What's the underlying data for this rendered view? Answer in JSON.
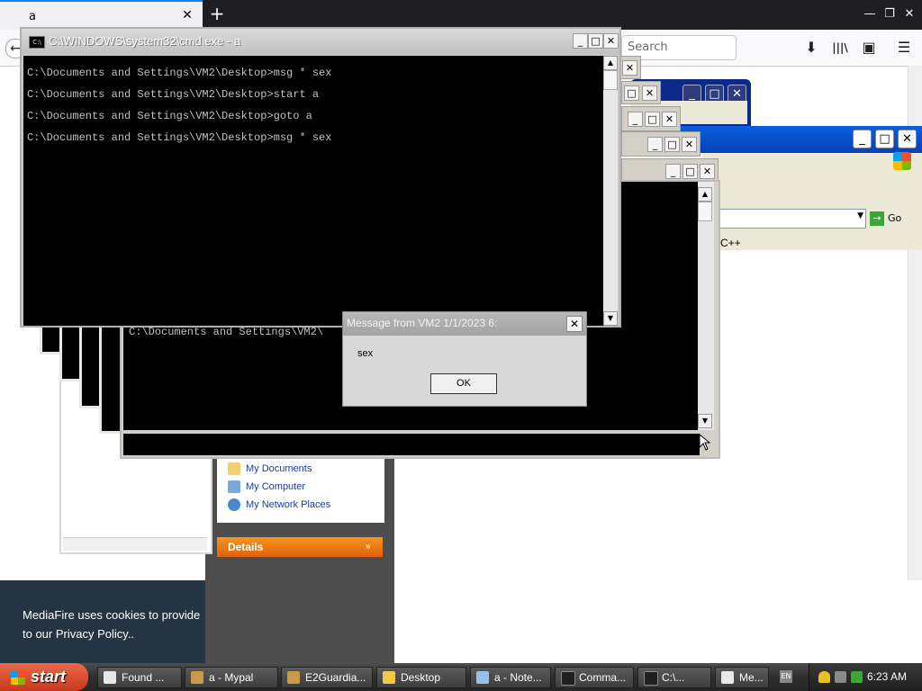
{
  "browser": {
    "tab_title": "a",
    "tab_close": "✕",
    "new_tab": "+",
    "search_placeholder": "Search",
    "back_icon": "←",
    "download_icon": "⬇",
    "library_icon": "|||\\",
    "sidebar_icon": "▣",
    "menu_icon": "☰",
    "win_minimize": "—",
    "win_restore": "❐",
    "win_close": "✕"
  },
  "cookie_banner": {
    "text": "MediaFire uses cookies to provide",
    "text2_prefix": "to our ",
    "policy_link": "Privacy Policy",
    "text2_suffix": ".."
  },
  "mediafire": {
    "list": [
      "My Documents",
      "My Computer",
      "My Network Places"
    ],
    "details_label": "Details",
    "details_arrow": "»"
  },
  "explorer": {
    "go_label": "Go",
    "go_arrow": "→",
    "dropdown_arrow": "▼",
    "content_text": "C++"
  },
  "cmd": {
    "title": "C:\\WINDOWS\\system32\\cmd.exe - a",
    "icon_text": "C:\\",
    "lines": [
      "C:\\Documents and Settings\\VM2\\Desktop>msg * sex",
      "C:\\Documents and Settings\\VM2\\Desktop>start a",
      "C:\\Documents and Settings\\VM2\\Desktop>goto a",
      "C:\\Documents and Settings\\VM2\\Desktop>msg * sex"
    ],
    "minimize": "_",
    "maximize": "□",
    "close": "✕",
    "scroll_up": "▲",
    "scroll_down": "▼"
  },
  "cmd2": {
    "line": "C:\\Documents and Settings\\VM2\\"
  },
  "message": {
    "title": "Message from VM2 1/1/2023 6:",
    "body": "sex",
    "ok": "OK",
    "close": "✕"
  },
  "taskbar": {
    "start": "start",
    "items": [
      "Found ...",
      "a - Mypal",
      "E2Guardia...",
      "Desktop",
      "a - Note...",
      "Comma...",
      "C:\\...",
      "Me..."
    ],
    "lang": "EN",
    "clock": "6:23 AM"
  },
  "colors": {
    "taskbar_icon_colors": [
      "#e8e8e8",
      "#c89a4a",
      "#c89a4a",
      "#f0c84a",
      "#9ac0e8",
      "#202020",
      "#202020",
      "#e8e8e8"
    ]
  }
}
